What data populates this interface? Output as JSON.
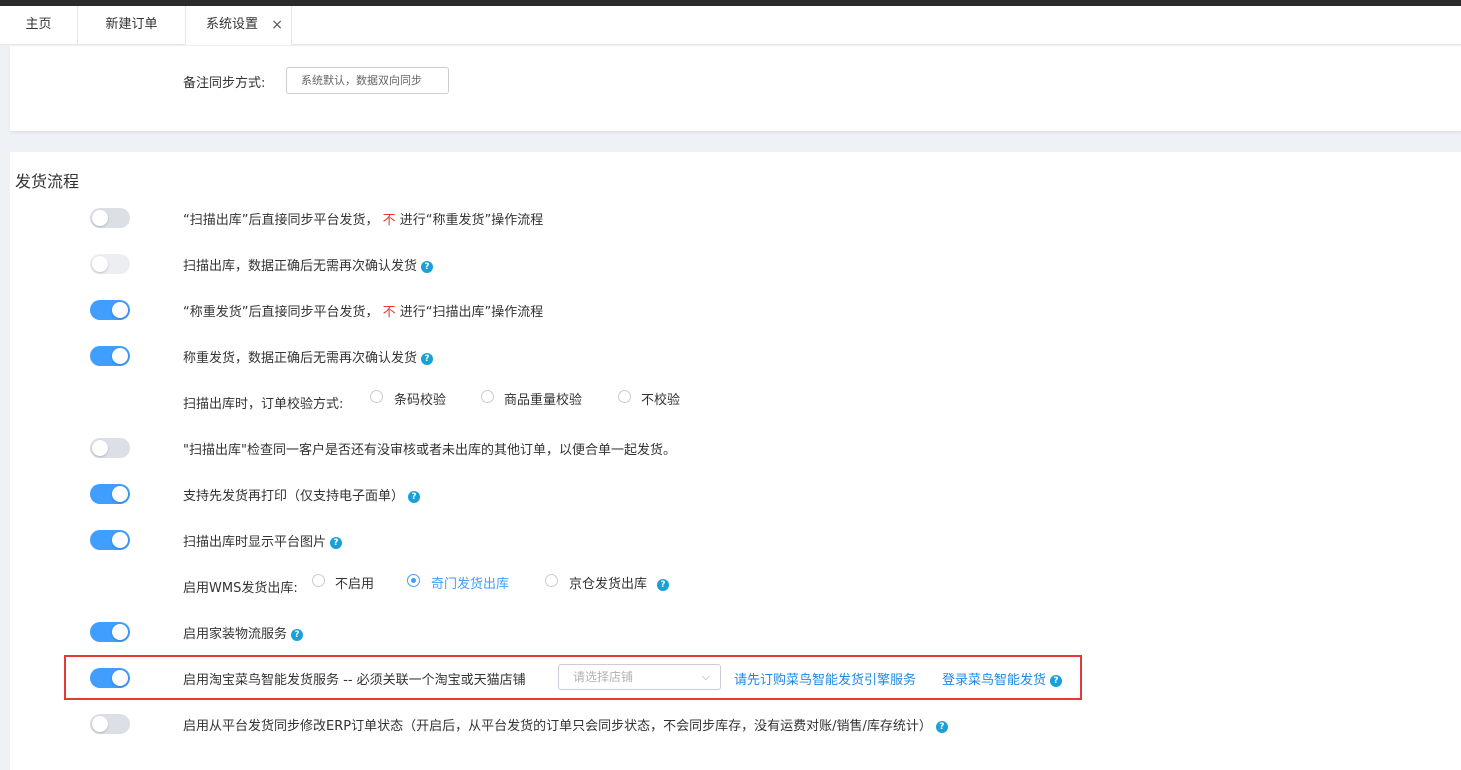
{
  "tabs": [
    {
      "label": "主页"
    },
    {
      "label": "新建订单"
    },
    {
      "label": "系统设置",
      "close": "×"
    }
  ],
  "remark": {
    "label": "备注同步方式:",
    "value": "系统默认，数据双向同步"
  },
  "section": {
    "title": "发货流程"
  },
  "rows": {
    "r1": {
      "pre": "“扫描出库”后直接同步平台发货，",
      "neg": "不",
      "post": "进行“称重发货”操作流程",
      "enabled": false
    },
    "r2": {
      "text": "扫描出库，数据正确后无需再次确认发货",
      "enabled": false,
      "disabled": true
    },
    "r3": {
      "pre": "“称重发货”后直接同步平台发货，",
      "neg": "不",
      "post": "进行“扫描出库”操作流程",
      "enabled": true
    },
    "r4": {
      "text": "称重发货，数据正确后无需再次确认发货",
      "enabled": true
    },
    "r5": {
      "label": "扫描出库时，订单校验方式:",
      "options": [
        "条码校验",
        "商品重量校验",
        "不校验"
      ]
    },
    "r6": {
      "text": "\"扫描出库\"检查同一客户是否还有没审核或者未出库的其他订单，以便合单一起发货。",
      "enabled": false
    },
    "r7": {
      "text": "支持先发货再打印（仅支持电子面单）",
      "enabled": true
    },
    "r8": {
      "text": "扫描出库时显示平台图片",
      "enabled": true
    },
    "r9": {
      "label": "启用WMS发货出库:",
      "options": [
        "不启用",
        "奇门发货出库",
        "京仓发货出库"
      ],
      "selected": "奇门发货出库"
    },
    "r10": {
      "text": "启用家装物流服务",
      "enabled": true
    },
    "r11": {
      "text": "启用淘宝菜鸟智能发货服务 -- 必须关联一个淘宝或天猫店铺",
      "placeholder": "请选择店铺",
      "link1": "请先订购菜鸟智能发货引擎服务",
      "link2": "登录菜鸟智能发货",
      "enabled": true
    },
    "r12": {
      "text": "启用从平台发货同步修改ERP订单状态（开启后，从平台发货的订单只会同步状态，不会同步库存，没有运费对账/销售/库存统计）",
      "enabled": false
    }
  },
  "icons": {
    "help": "?",
    "chevron": "⌵"
  },
  "colors": {
    "accent": "#409eff",
    "warning": "#e53935",
    "link": "#1e88e5",
    "help": "#1aa0d8"
  }
}
